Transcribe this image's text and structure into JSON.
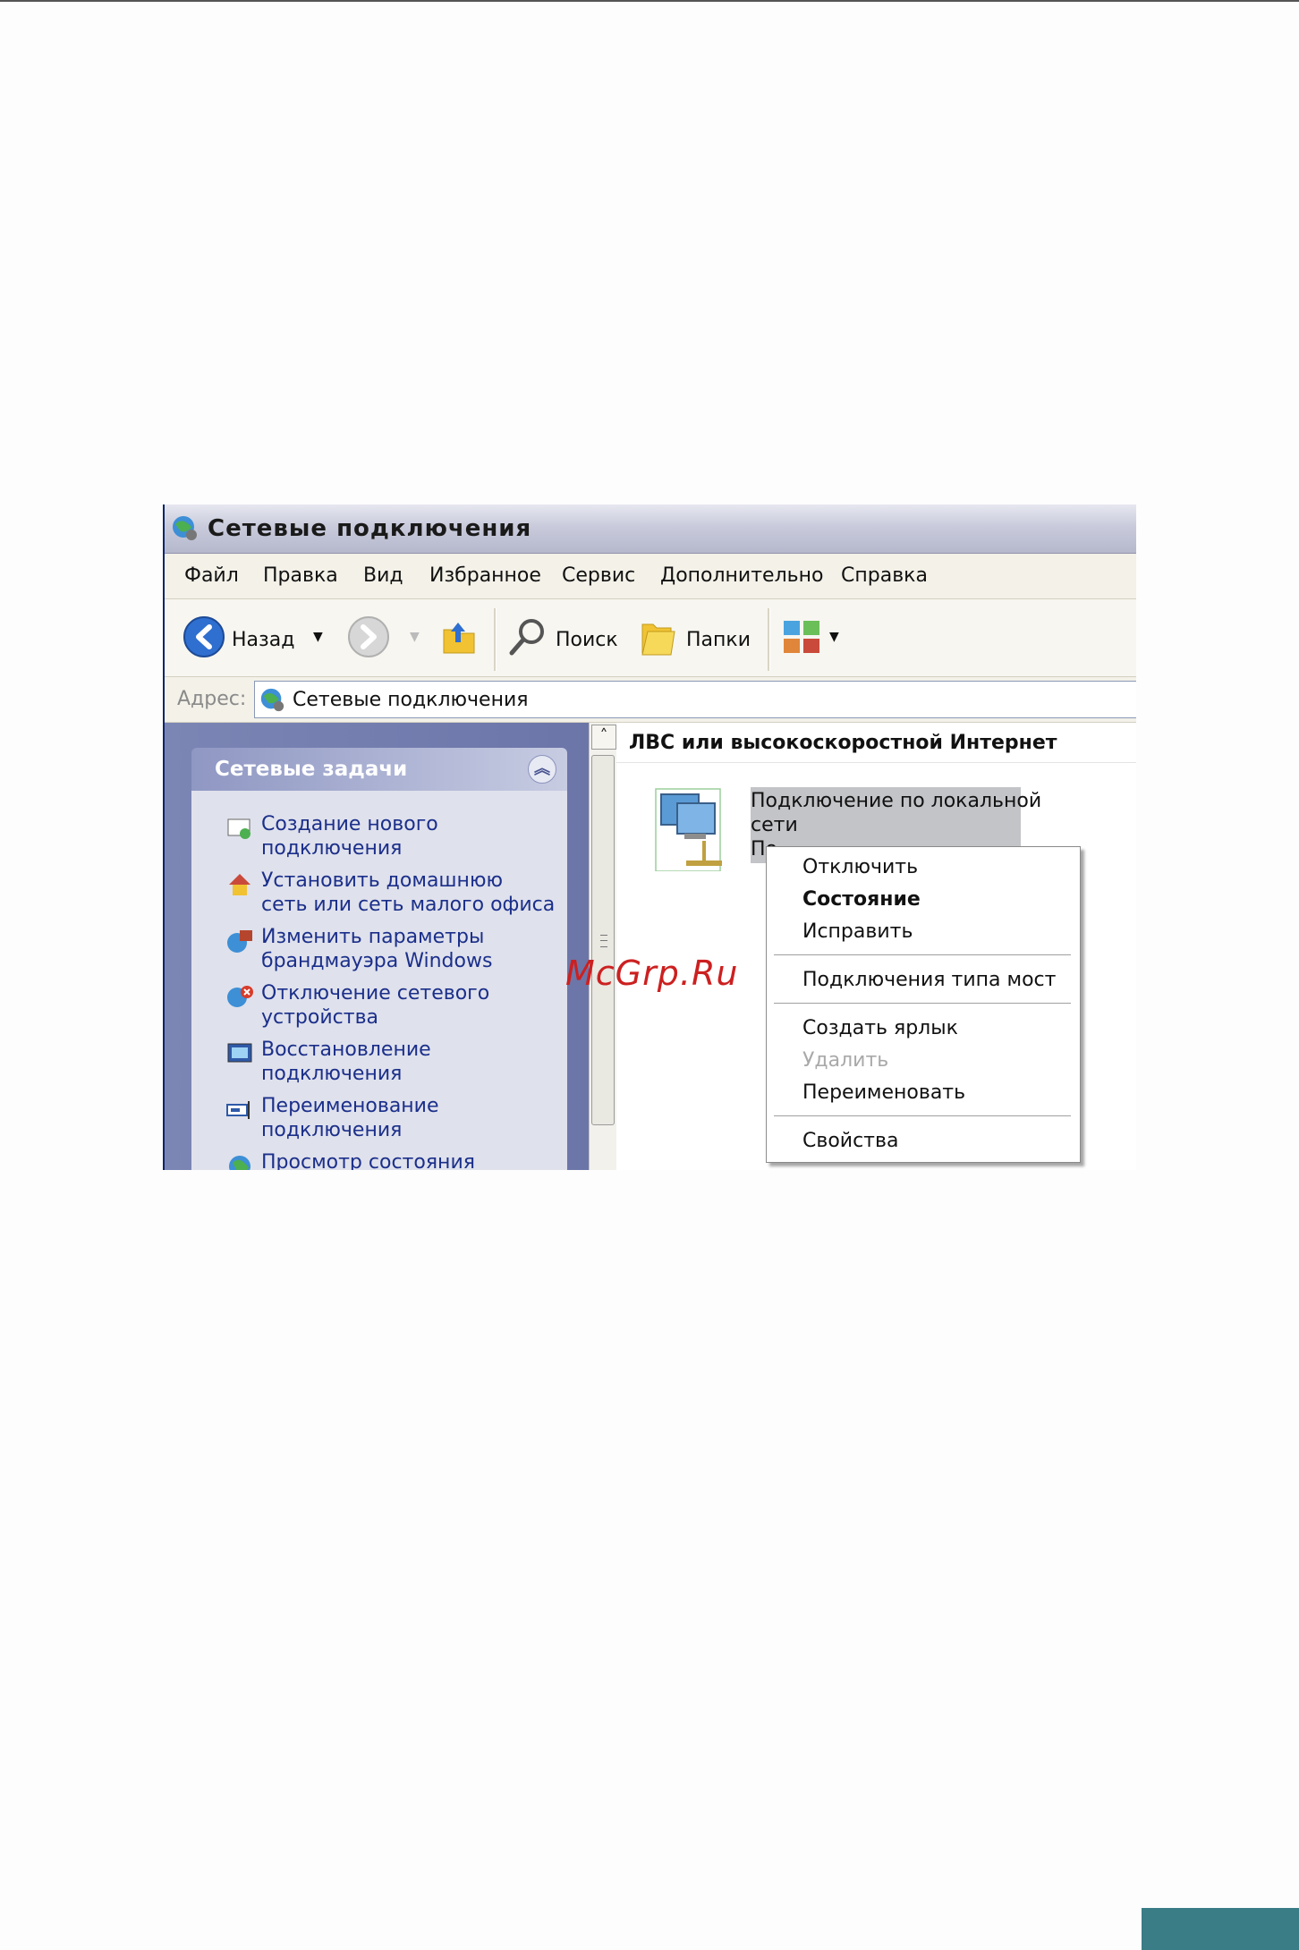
{
  "window": {
    "title": "Сетевые подключения"
  },
  "menu": [
    "Файл",
    "Правка",
    "Вид",
    "Избранное",
    "Сервис",
    "Дополнительно",
    "Справка"
  ],
  "toolbar": {
    "back": "Назад",
    "search": "Поиск",
    "folders": "Папки"
  },
  "address": {
    "label": "Адрес:",
    "value": "Сетевые подключения"
  },
  "tasks": {
    "title": "Сетевые задачи",
    "items": [
      "Создание нового\nподключения",
      "Установить домашнюю\nсеть или сеть малого офиса",
      "Изменить параметры\nбрандмауэра Windows",
      "Отключение сетевого\nустройства",
      "Восстановление\nподключения",
      "Переименование\nподключения",
      "Просмотр состояния"
    ]
  },
  "content": {
    "group": "ЛВС или высокоскоростной Интернет",
    "connection": {
      "line1": "Подключение по локальной",
      "line2": "сети",
      "line3": "По"
    }
  },
  "context_menu": {
    "disconnect": "Отключить",
    "status": "Состояние",
    "repair": "Исправить",
    "bridge": "Подключения типа мост",
    "shortcut": "Создать ярлык",
    "delete": "Удалить",
    "rename": "Переименовать",
    "properties": "Свойства"
  },
  "watermark": "McGrp.Ru",
  "colors": {
    "accent_tab": "#3a7d86",
    "task_link": "#1b2f8a",
    "watermark": "#cc2020"
  }
}
